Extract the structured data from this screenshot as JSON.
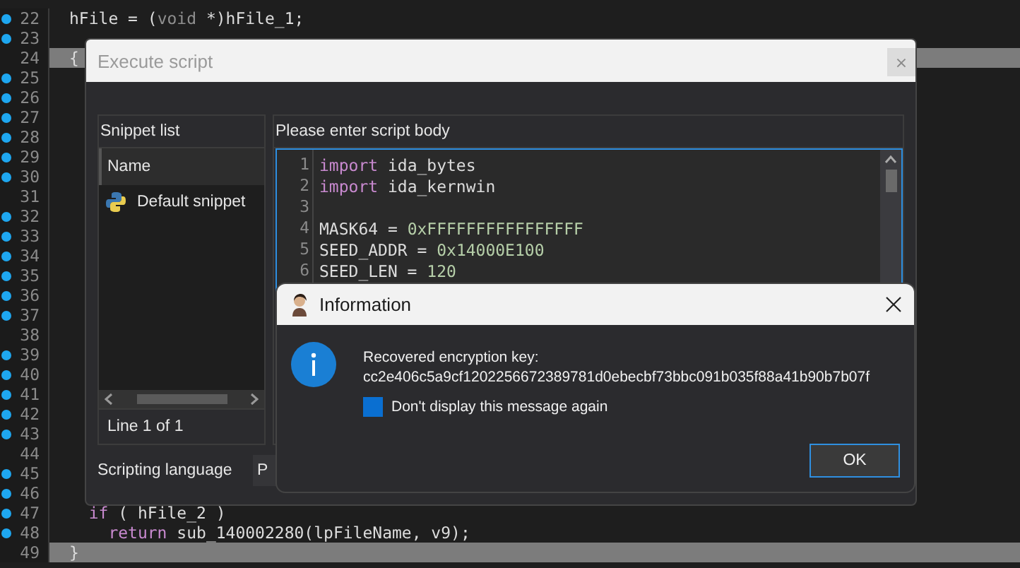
{
  "editor": {
    "lines": [
      {
        "number": "22",
        "marked": true,
        "highlighted": false,
        "tokens": [
          {
            "text": "hFile = (",
            "kind": "plain"
          },
          {
            "text": "void",
            "kind": "type"
          },
          {
            "text": " *)hFile_1;",
            "kind": "plain"
          }
        ]
      },
      {
        "number": "23",
        "marked": true,
        "highlighted": false
      },
      {
        "number": "24",
        "marked": false,
        "highlighted": true,
        "tokens": [
          {
            "text": "{",
            "kind": "plain"
          }
        ]
      },
      {
        "number": "25",
        "marked": true,
        "highlighted": false
      },
      {
        "number": "26",
        "marked": true,
        "highlighted": false
      },
      {
        "number": "27",
        "marked": true,
        "highlighted": false
      },
      {
        "number": "28",
        "marked": true,
        "highlighted": false
      },
      {
        "number": "29",
        "marked": true,
        "highlighted": false
      },
      {
        "number": "30",
        "marked": true,
        "highlighted": false
      },
      {
        "number": "31",
        "marked": false,
        "highlighted": false
      },
      {
        "number": "32",
        "marked": true,
        "highlighted": false
      },
      {
        "number": "33",
        "marked": true,
        "highlighted": false
      },
      {
        "number": "34",
        "marked": true,
        "highlighted": false
      },
      {
        "number": "35",
        "marked": true,
        "highlighted": false
      },
      {
        "number": "36",
        "marked": true,
        "highlighted": false
      },
      {
        "number": "37",
        "marked": true,
        "highlighted": false
      },
      {
        "number": "38",
        "marked": false,
        "highlighted": false
      },
      {
        "number": "39",
        "marked": true,
        "highlighted": false
      },
      {
        "number": "40",
        "marked": true,
        "highlighted": false
      },
      {
        "number": "41",
        "marked": true,
        "highlighted": false
      },
      {
        "number": "42",
        "marked": true,
        "highlighted": false
      },
      {
        "number": "43",
        "marked": true,
        "highlighted": false
      },
      {
        "number": "44",
        "marked": false,
        "highlighted": false
      },
      {
        "number": "45",
        "marked": true,
        "highlighted": false
      },
      {
        "number": "46",
        "marked": true,
        "highlighted": false
      },
      {
        "number": "47",
        "marked": true,
        "highlighted": false,
        "tokens": [
          {
            "text": "  if",
            "kind": "keyword"
          },
          {
            "text": " ( hFile_2 )",
            "kind": "plain"
          }
        ]
      },
      {
        "number": "48",
        "marked": true,
        "highlighted": false,
        "tokens": [
          {
            "text": "    return",
            "kind": "keyword"
          },
          {
            "text": " sub_140002280(lpFileName, v9);",
            "kind": "plain"
          }
        ]
      },
      {
        "number": "49",
        "marked": false,
        "highlighted": true,
        "tokens": [
          {
            "text": "}",
            "kind": "plain"
          }
        ]
      }
    ]
  },
  "script_dialog": {
    "title": "Execute script",
    "close": "×",
    "snippet_panel": {
      "title": "Snippet list",
      "column": "Name",
      "items": [
        "Default snippet"
      ],
      "status": "Line 1 of 1"
    },
    "language": {
      "label": "Scripting language",
      "value": "P"
    },
    "script_panel": {
      "title": "Please enter script body",
      "lines": [
        {
          "number": "1",
          "tokens": [
            {
              "text": "import",
              "kind": "keyword"
            },
            {
              "text": " ida_bytes",
              "kind": "plain"
            }
          ]
        },
        {
          "number": "2",
          "tokens": [
            {
              "text": "import",
              "kind": "keyword"
            },
            {
              "text": " ida_kernwin",
              "kind": "plain"
            }
          ]
        },
        {
          "number": "3"
        },
        {
          "number": "4",
          "tokens": [
            {
              "text": "MASK64 = ",
              "kind": "plain"
            },
            {
              "text": "0xFFFFFFFFFFFFFFFF",
              "kind": "number"
            }
          ]
        },
        {
          "number": "5",
          "tokens": [
            {
              "text": "SEED_ADDR = ",
              "kind": "plain"
            },
            {
              "text": "0x14000E100",
              "kind": "number"
            }
          ]
        },
        {
          "number": "6",
          "tokens": [
            {
              "text": "SEED_LEN = ",
              "kind": "plain"
            },
            {
              "text": "120",
              "kind": "number"
            }
          ]
        }
      ]
    }
  },
  "info_dialog": {
    "title": "Information",
    "message": "Recovered encryption key:",
    "key": "cc2e406c5a9cf1202256672389781d0ebecbf73bbc091b035f88a41b90b7b07f",
    "checkbox": {
      "label": "Don't display this message again",
      "checked": true
    },
    "buttons": [
      "OK"
    ]
  }
}
